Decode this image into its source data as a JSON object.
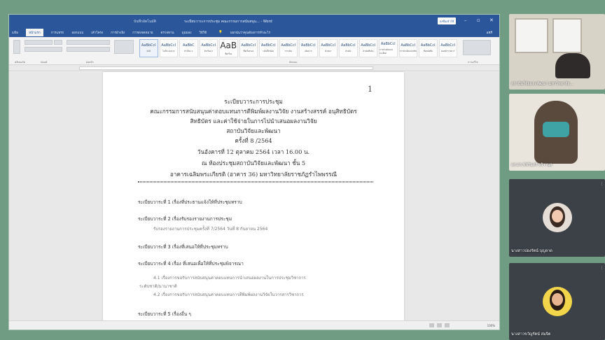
{
  "word": {
    "title": "ระเบียบวาระการประชุม คณะกรรมการสนับสนุน... - Word",
    "quick_access": "บันทึกอัตโนมัติ",
    "signin": "ลงชื่อเข้าใช้",
    "share": "แชร์",
    "tabs": [
      "แฟ้ม",
      "หน้าแรก",
      "การแทรก",
      "ออกแบบ",
      "เค้าโครง",
      "การอ้างอิง",
      "การส่งจดหมาย",
      "ตรวจทาน",
      "มุมมอง",
      "วิธีใช้"
    ],
    "tell_me": "บอกฉันว่าคุณต้องการทำอะไร",
    "styles": [
      {
        "label": "AaBbCcI",
        "name": "ปกติ"
      },
      {
        "label": "AaBbCcI",
        "name": "ไม่มีระยะห่าง"
      },
      {
        "label": "AaBbC",
        "name": "หัวเรื่อง 1"
      },
      {
        "label": "AaBbCcI",
        "name": "หัวเรื่อง 2"
      },
      {
        "label": "AaB",
        "name": "ชื่อเรื่อง"
      },
      {
        "label": "AaBbCcI",
        "name": "ชื่อเรื่องรอง"
      },
      {
        "label": "AaBbCcI",
        "name": "เน้นเล็กน้อย"
      },
      {
        "label": "AaBbCcI",
        "name": "การเน้น"
      },
      {
        "label": "AaBbCcI",
        "name": "เน้นมาก"
      },
      {
        "label": "AaBbCcI",
        "name": "ตัวหนา"
      },
      {
        "label": "AaBbCcI",
        "name": "อ้างอิง"
      },
      {
        "label": "AaBbCcI",
        "name": "อ้างอิงที่เน้น"
      },
      {
        "label": "AaBbCcI",
        "name": "การอ้างอิงแบบละเอียด"
      },
      {
        "label": "AaBbCcI",
        "name": "การอ้างอิงแบบเข้ม"
      },
      {
        "label": "AaBbCcI",
        "name": "ชื่อหนังสือ"
      },
      {
        "label": "AaBbCcI",
        "name": "ย่อหน้ารายการ"
      }
    ],
    "group_labels": {
      "clipboard": "คลิปบอร์ด",
      "font": "ฟอนต์",
      "paragraph": "ย่อหน้า",
      "styles": "ลักษณะ",
      "editing": "การแก้ไข"
    },
    "status": {
      "zoom": "100%"
    }
  },
  "document": {
    "page_number": "1",
    "heading": [
      "ระเบียบวาระการประชุม",
      "คณะกรรมการสนับสนุนค่าตอบแทนการตีพิมพ์ผลงานวิจัย งานสร้างสรรค์ อนุสิทธิบัตร",
      "สิทธิบัตร และค่าใช้จ่ายในการไปนำเสนอผลงานวิจัย",
      "สถาบันวิจัยและพัฒนา",
      "ครั้งที่ 8 /2564",
      "วันอังคารที่ 12 ตุลาคม 2564 เวลา 16.00 น.",
      "ณ ห้องประชุมสถาบันวิจัยและพัฒนา ชั้น 5",
      "อาคารเฉลิมพระเกียรติ (อาคาร 36) มหาวิทยาลัยราชภัฏรำไพพรรณี"
    ],
    "agenda": [
      "ระเบียบวาระที่ 1 เรื่องที่ประธานแจ้งให้ที่ประชุมทราบ",
      "ระเบียบวาระที่ 2 เรื่องรับรองรายงานการประชุม",
      "ระเบียบวาระที่ 3 เรื่องที่เสนอให้ที่ประชุมทราบ",
      "ระเบียบวาระที่ 4 เรื่อง ที่เสนอเพื่อให้ที่ประชุมพิจารณา",
      "ระเบียบวาระที่ 5 เรื่องอื่น ๆ"
    ],
    "agenda2_sub": "รับรองรายงานการประชุมครั้งที่ 7/2564 วันที่ 8 กันยายน 2564",
    "agenda4_sub": [
      "4.1 เรื่องการขอรับการสนับสนุนค่าตอบแทนการนำเสนอผลงานในการประชุมวิชาการ",
      "ระดับชาติ/นานาชาติ",
      "4.2 เรื่องการขอรับการสนับสนุนค่าตอบแทนการตีพิมพ์ผลงานวิจัยในวารสารวิชาการ"
    ]
  },
  "participants": [
    {
      "name": "สถาบันวิจัยและพัฒนา มหาวิทยาลัย..."
    },
    {
      "name": "ผศ.ดร.พัชรินทร์ จริวานุล"
    },
    {
      "name": "นางสาวปองรัตน์ บุญลาด"
    },
    {
      "name": "นางสาวขวัญรัตน์ สมจิต"
    }
  ]
}
